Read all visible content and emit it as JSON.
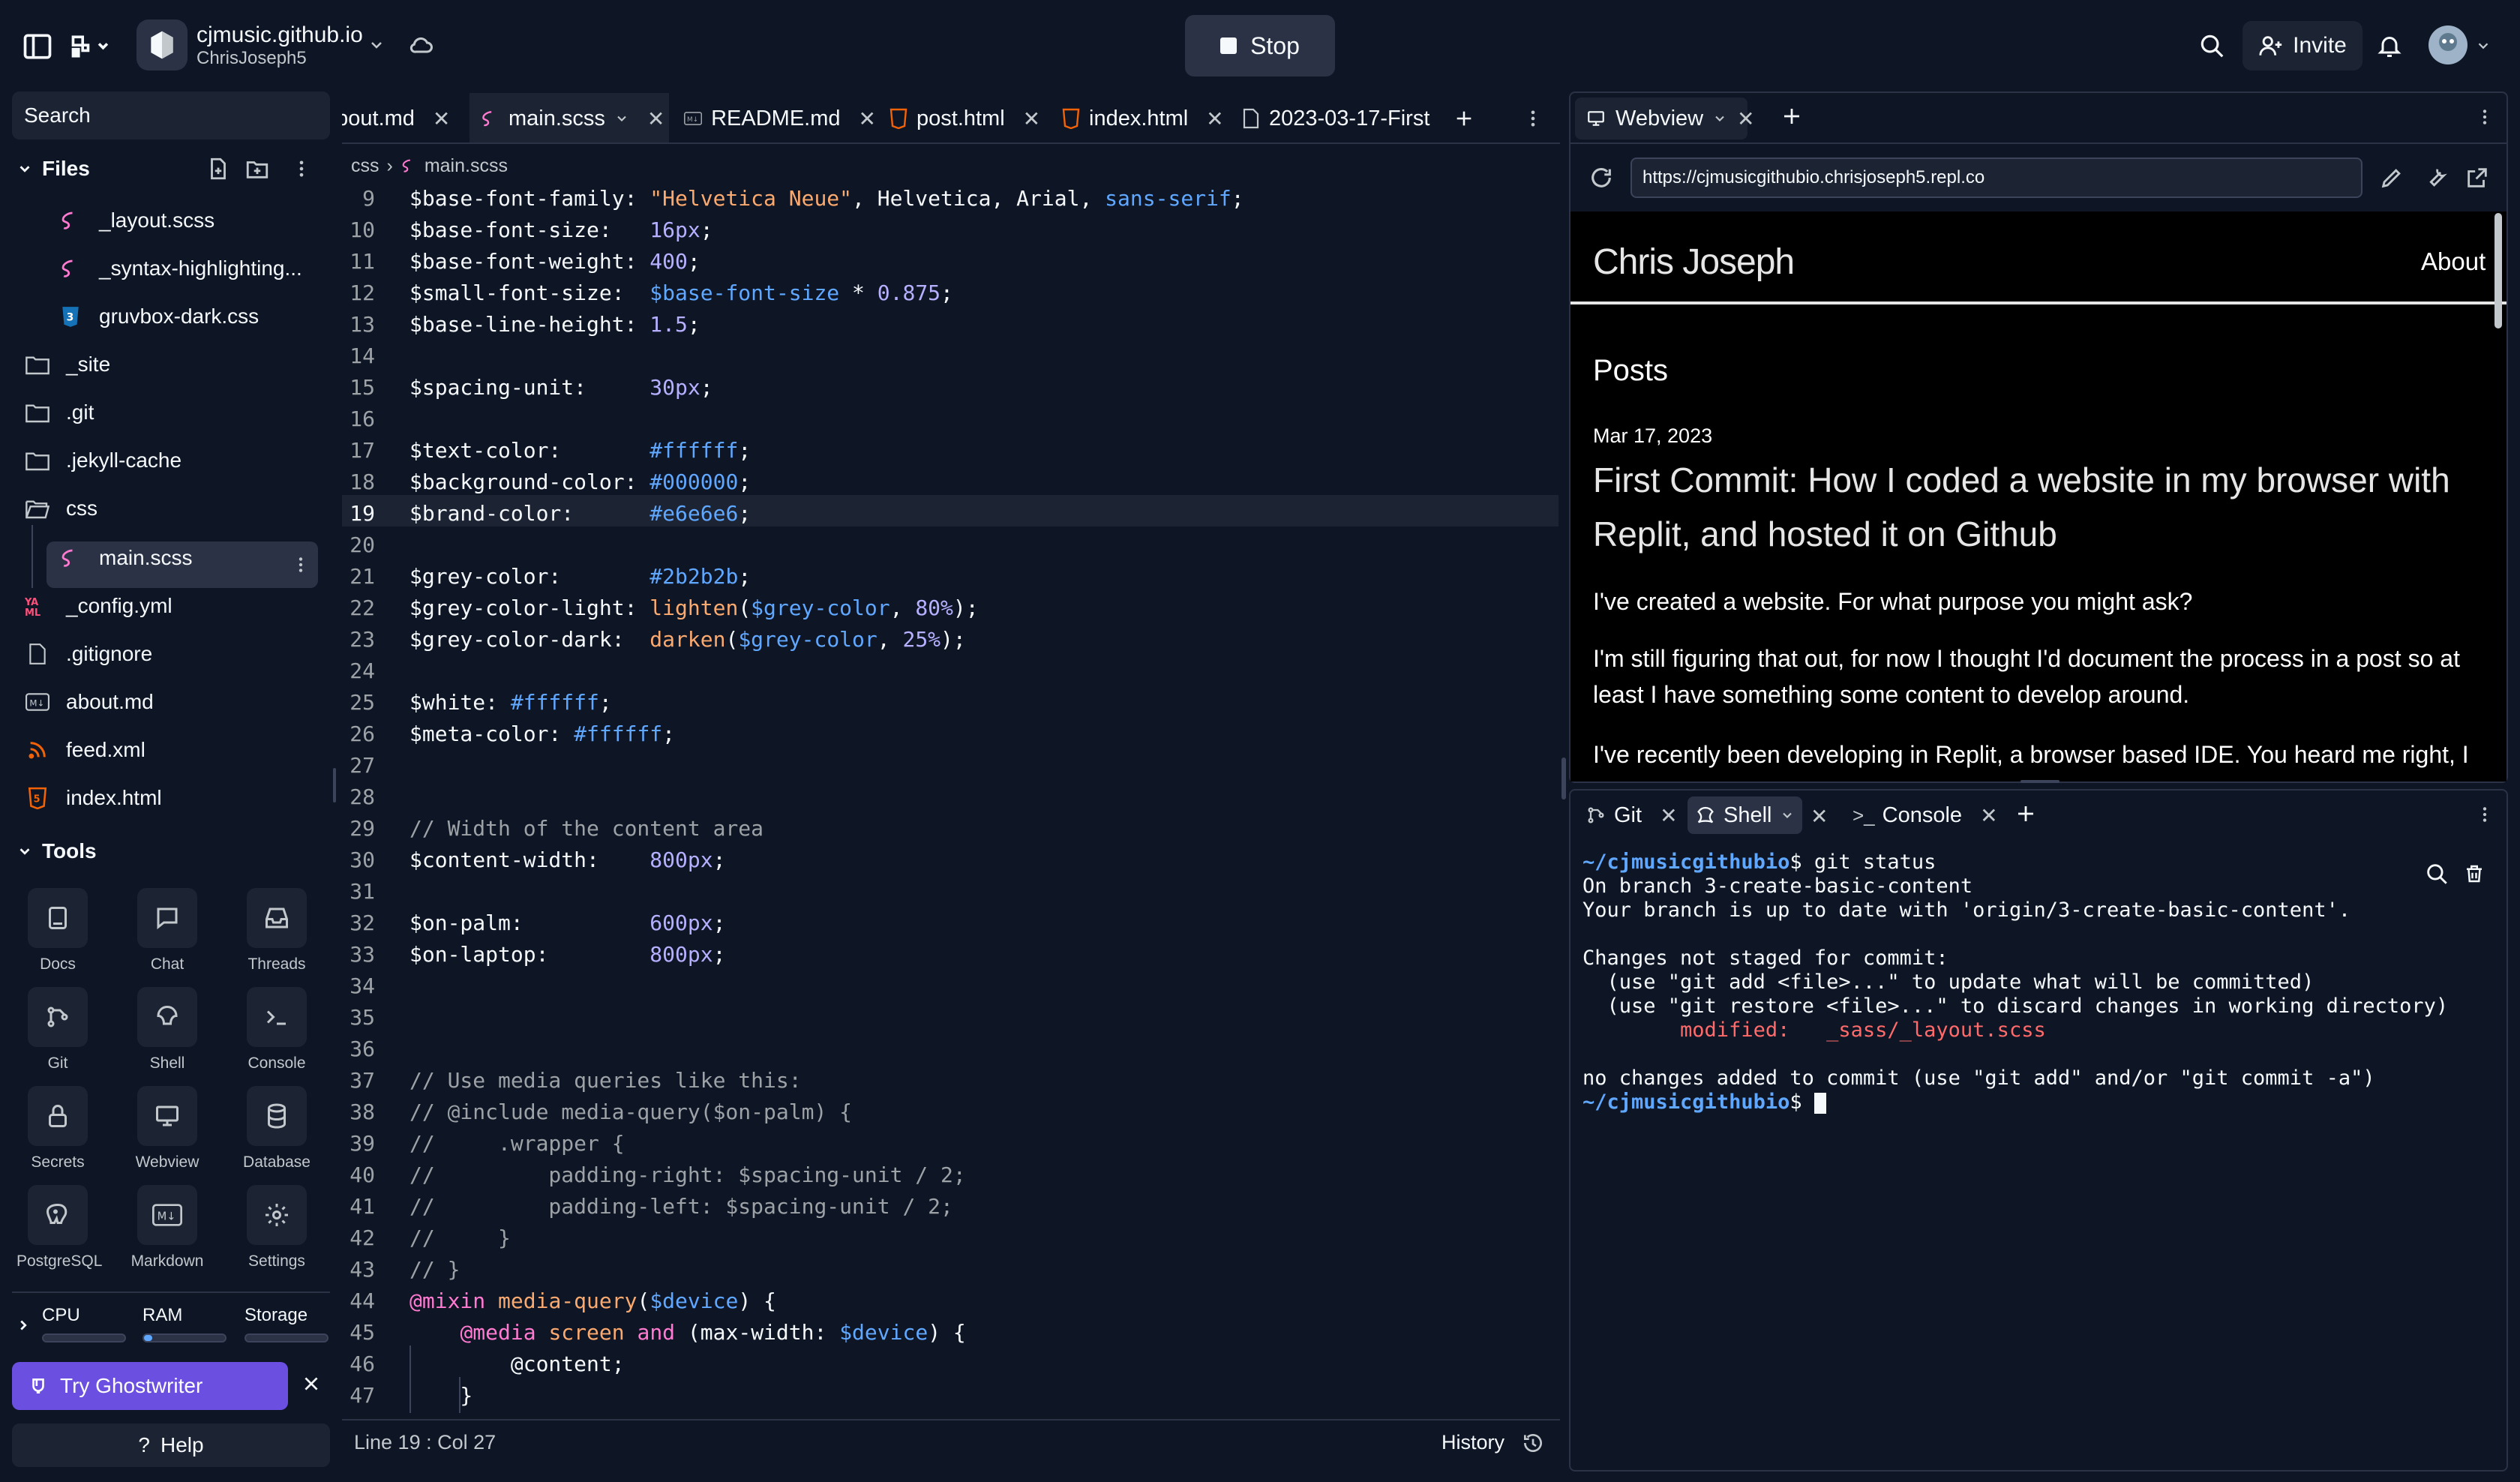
{
  "topbar": {
    "repl_name": "cjmusic.github.io",
    "repl_owner": "ChrisJoseph5",
    "stop_label": "Stop",
    "invite_label": "Invite"
  },
  "sidebar": {
    "search_placeholder": "Search",
    "files_header": "Files",
    "tree": [
      {
        "label": "_layout.scss",
        "icon": "sass-icon"
      },
      {
        "label": "_syntax-highlighting...",
        "icon": "sass-icon"
      },
      {
        "label": "gruvbox-dark.css",
        "icon": "css-icon"
      },
      {
        "label": "_site",
        "icon": "folder-icon"
      },
      {
        "label": ".git",
        "icon": "folder-icon"
      },
      {
        "label": ".jekyll-cache",
        "icon": "folder-icon"
      },
      {
        "label": "css",
        "icon": "folder-open-icon"
      },
      {
        "label": "main.scss",
        "icon": "sass-icon"
      },
      {
        "label": "_config.yml",
        "icon": "yaml-icon"
      },
      {
        "label": ".gitignore",
        "icon": "file-icon"
      },
      {
        "label": "about.md",
        "icon": "markdown-icon"
      },
      {
        "label": "feed.xml",
        "icon": "rss-icon"
      },
      {
        "label": "index.html",
        "icon": "html-icon"
      }
    ],
    "tools_header": "Tools",
    "tools": [
      {
        "label": "Docs",
        "icon": "docs-icon"
      },
      {
        "label": "Chat",
        "icon": "chat-icon"
      },
      {
        "label": "Threads",
        "icon": "threads-icon"
      },
      {
        "label": "Git",
        "icon": "git-icon"
      },
      {
        "label": "Shell",
        "icon": "shell-icon"
      },
      {
        "label": "Console",
        "icon": "console-icon"
      },
      {
        "label": "Secrets",
        "icon": "lock-icon"
      },
      {
        "label": "Webview",
        "icon": "monitor-icon"
      },
      {
        "label": "Database",
        "icon": "database-icon"
      },
      {
        "label": "PostgreSQL",
        "icon": "postgres-icon"
      },
      {
        "label": "Markdown",
        "icon": "markdown-icon"
      },
      {
        "label": "Settings",
        "icon": "gear-icon"
      }
    ],
    "resources": {
      "cpu": "CPU",
      "ram": "RAM",
      "storage": "Storage",
      "ram_fill": 0.1
    },
    "ghostwriter_label": "Try Ghostwriter",
    "help_label": "Help"
  },
  "editor": {
    "tabs": [
      {
        "label": "about.md"
      },
      {
        "label": "main.scss"
      },
      {
        "label": "README.md"
      },
      {
        "label": "post.html"
      },
      {
        "label": "index.html"
      },
      {
        "label": "2023-03-17-First"
      }
    ],
    "crumb_folder": "css",
    "crumb_file": "main.scss",
    "line_numbers": [
      "9",
      "10",
      "11",
      "12",
      "13",
      "14",
      "15",
      "16",
      "17",
      "18",
      "19",
      "20",
      "21",
      "22",
      "23",
      "24",
      "25",
      "26",
      "27",
      "28",
      "29",
      "30",
      "31",
      "32",
      "33",
      "34",
      "35",
      "36",
      "37",
      "38",
      "39",
      "40",
      "41",
      "42",
      "43",
      "44",
      "45",
      "46",
      "47"
    ],
    "status_position": "Line 19 : Col 27",
    "history_label": "History"
  },
  "webview": {
    "tab_label": "Webview",
    "url": "https://cjmusicgithubio.chrisjoseph5.repl.co",
    "site_title": "Chris Joseph",
    "nav_about": "About",
    "posts_heading": "Posts",
    "post_date": "Mar 17, 2023",
    "post_title": "First Commit: How I coded a website in my browser with Replit, and hosted it on Github",
    "para1": "I've created a website. For what purpose you might ask?",
    "para2": "I'm still figuring that out, for now I thought I'd document the process in a post so at least I have something some content to develop around.",
    "para3": "I've recently been developing in Replit, a browser based IDE. You heard me right, I"
  },
  "shell": {
    "tabs": [
      {
        "label": "Git"
      },
      {
        "label": "Shell"
      },
      {
        "label": "Console"
      }
    ],
    "prompt_path": "~/cjmusicgithubio",
    "cmd1": "$ git status",
    "l1": "On branch 3-create-basic-content",
    "l2": "Your branch is up to date with 'origin/3-create-basic-content'.",
    "l3": "Changes not staged for commit:",
    "l4": "  (use \"git add <file>...\" to update what will be committed)",
    "l5": "  (use \"git restore <file>...\" to discard changes in working directory)",
    "l6": "        modified:   _sass/_layout.scss",
    "l7": "no changes added to commit (use \"git add\" and/or \"git commit -a\")",
    "prompt2": "$ "
  },
  "colors": {
    "accent": "#6b4fe0",
    "bg": "#0e1525",
    "surface": "#1c2333"
  }
}
